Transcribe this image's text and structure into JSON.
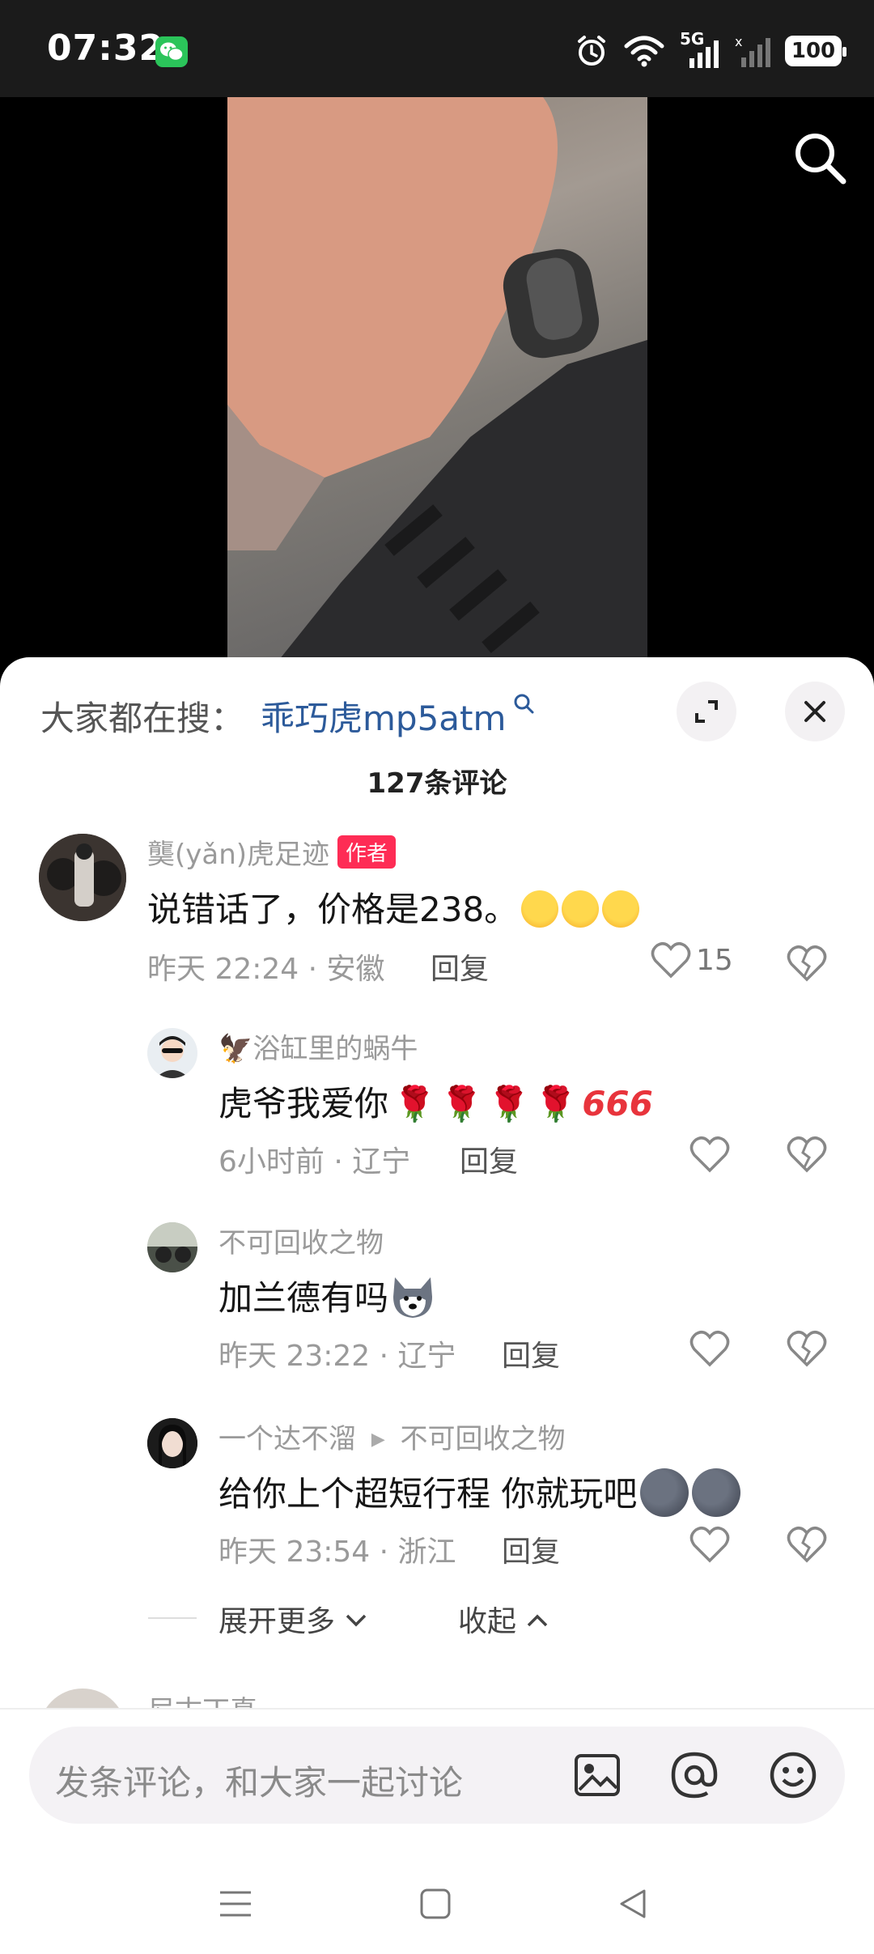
{
  "status_bar": {
    "time": "07:32",
    "battery": "100",
    "network": "5G",
    "icons": [
      "wechat-icon",
      "alarm-icon",
      "wifi-icon",
      "signal-icon",
      "battery-icon"
    ]
  },
  "trending": {
    "prefix": "大家都在搜：",
    "term": "乖巧虎mp5atm"
  },
  "comment_count": "127条评论",
  "comments": [
    {
      "name": "龑(yǎn)虎足迹",
      "tag": "作者",
      "text": "说错话了，价格是238。",
      "time_location": "昨天 22:24 · 安徽",
      "reply": "回复",
      "likes": "15",
      "emojis": [
        "laugh-cry",
        "laugh-cry",
        "laugh-cry"
      ]
    },
    {
      "name": "🦅浴缸里的蜗牛",
      "text": "虎爷我爱你",
      "time_location": "6小时前 · 辽宁",
      "reply": "回复",
      "emojis": [
        "rose",
        "rose",
        "rose",
        "rose",
        "666"
      ]
    },
    {
      "name": "不可回收之物",
      "text": "加兰德有吗",
      "time_location": "昨天 23:22 · 辽宁",
      "reply": "回复",
      "emojis": [
        "husky"
      ]
    },
    {
      "name": "一个达不溜",
      "reply_to": "不可回收之物",
      "text": "给你上个超短行程 你就玩吧",
      "time_location": "昨天 23:54 · 浙江",
      "reply": "回复",
      "emojis": [
        "dark-moon",
        "dark-moon"
      ]
    }
  ],
  "expand": {
    "more": "展开更多",
    "collapse": "收起"
  },
  "next_comment_name": "尼古丁真",
  "input": {
    "placeholder": "发条评论，和大家一起讨论"
  },
  "colors": {
    "accent": "#fe2c55",
    "link": "#2c5a9a",
    "sheet": "#ffffff",
    "input_bg": "#f4f2f5"
  }
}
